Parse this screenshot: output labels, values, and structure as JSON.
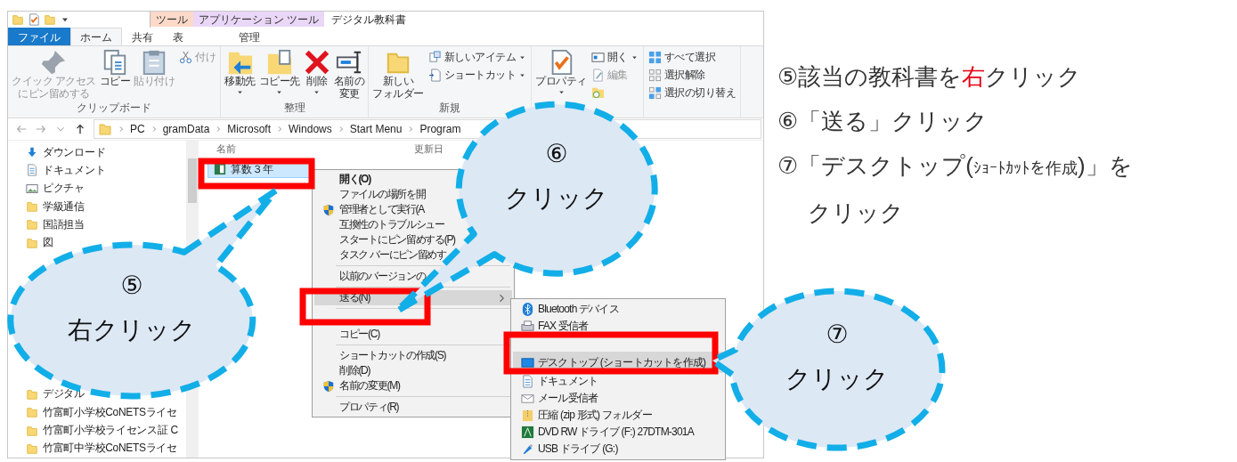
{
  "window": {
    "title": "デジタル教科書",
    "context_tabs": [
      {
        "label": "ツール",
        "color": "#fcd9c9"
      },
      {
        "label": "アプリケーション ツール",
        "color": "#ead7f7",
        "tab": {
          "label": "管理",
          "selected": false
        }
      }
    ]
  },
  "tabs": [
    {
      "label": "ファイル",
      "kind": "file",
      "selected": false
    },
    {
      "label": "ホーム",
      "kind": "tab",
      "selected": true
    },
    {
      "label": "共有",
      "kind": "tab",
      "selected": false
    },
    {
      "label": "表",
      "kind": "tab",
      "selected": false
    }
  ],
  "ribbon": {
    "groups": [
      {
        "label": "クリップボード",
        "items": [
          {
            "lines": [
              "クイック アクセス",
              "にピン留めする"
            ],
            "kind": "large",
            "disabled": true
          },
          {
            "lines": [
              "コピー"
            ],
            "kind": "large",
            "disabled": false
          },
          {
            "lines": [
              "貼り付け"
            ],
            "kind": "large",
            "disabled": true
          },
          {
            "lines": [
              "付け"
            ],
            "kind": "small",
            "disabled": true
          }
        ]
      },
      {
        "label": "整理",
        "items": [
          {
            "lines": [
              "移動先"
            ],
            "kind": "large",
            "disabled": false,
            "dropdown": true
          },
          {
            "lines": [
              "コピー先"
            ],
            "kind": "large",
            "disabled": false,
            "dropdown": true
          },
          {
            "lines": [
              "削除"
            ],
            "kind": "large",
            "disabled": false,
            "dropdown": true
          },
          {
            "lines": [
              "名前の",
              "変更"
            ],
            "kind": "large",
            "disabled": false
          }
        ]
      },
      {
        "label": "新規",
        "items": [
          {
            "lines": [
              "新しい",
              "フォルダー"
            ],
            "kind": "large",
            "disabled": false
          },
          {
            "lines": [
              "新しいアイテム"
            ],
            "kind": "small",
            "disabled": false,
            "dropdown": true
          },
          {
            "lines": [
              "ショートカット"
            ],
            "kind": "small",
            "disabled": false,
            "dropdown": true
          }
        ]
      },
      {
        "items": [
          {
            "lines": [
              "プロパティ"
            ],
            "kind": "large",
            "disabled": false,
            "dropdown": true
          },
          {
            "lines": [
              "開く"
            ],
            "kind": "small",
            "disabled": false,
            "dropdown": true
          },
          {
            "lines": [
              "編集"
            ],
            "kind": "small",
            "disabled": true
          },
          {
            "kind": "small"
          }
        ]
      },
      {
        "items": [
          {
            "lines": [
              "すべて選択"
            ],
            "kind": "small",
            "disabled": false
          },
          {
            "lines": [
              "選択解除"
            ],
            "kind": "small",
            "disabled": false
          },
          {
            "lines": [
              "選択の切り替え"
            ],
            "kind": "small",
            "disabled": false
          }
        ]
      }
    ]
  },
  "address_bar": {
    "crumbs": [
      "PC",
      "gramData",
      "Microsoft",
      "Windows",
      "Start Menu",
      "Program"
    ]
  },
  "nav_pane": {
    "items_top": [
      "ダウンロード",
      "ドキュメント",
      "ピクチャ",
      "学級通信",
      "国語担当",
      "図"
    ],
    "items_bottom": [
      "デジタル",
      "竹富町小学校CoNETSライセ",
      "竹富町小学校ライセンス証 C",
      "竹富町中学校CoNETSライセ"
    ]
  },
  "file_list": {
    "columns": [
      "名前",
      "更新日"
    ],
    "rows": [
      {
        "name": "算数３年",
        "selected": true
      }
    ]
  },
  "context_menu": {
    "items": [
      {
        "kind": "item",
        "label": "開く(O)",
        "bold": true,
        "selected": false
      },
      {
        "kind": "item",
        "label": "ファイルの場所を開",
        "selected": false
      },
      {
        "kind": "item",
        "label": "管理者として実行(A",
        "shield": true,
        "selected": false
      },
      {
        "kind": "item",
        "label": "互換性のトラブルシュー",
        "selected": false
      },
      {
        "kind": "item",
        "label": "スタートにピン留めする(P)",
        "selected": false
      },
      {
        "kind": "item",
        "label": "タスク バーにピン留めす",
        "selected": false
      },
      {
        "kind": "separator"
      },
      {
        "kind": "item",
        "label": "以前のバージョンの",
        "selected": false
      },
      {
        "kind": "separator"
      },
      {
        "kind": "item",
        "label": "送る(N)",
        "submenu": true,
        "selected": true
      },
      {
        "kind": "separator"
      },
      {
        "kind": "blank"
      },
      {
        "kind": "item",
        "label": "コピー(C)",
        "selected": false
      },
      {
        "kind": "separator"
      },
      {
        "kind": "item",
        "label": "ショートカットの作成(S)",
        "selected": false
      },
      {
        "kind": "item",
        "label": "削除(D)",
        "selected": false
      },
      {
        "kind": "item",
        "label": "名前の変更(M)",
        "shield": true,
        "selected": false
      },
      {
        "kind": "separator"
      },
      {
        "kind": "item",
        "label": "プロパティ(R)",
        "selected": false
      }
    ]
  },
  "send_to_menu": {
    "items": [
      {
        "kind": "item",
        "label": "Bluetooth デバイス",
        "selected": false
      },
      {
        "kind": "item",
        "label": "FAX 受信者",
        "selected": false
      },
      {
        "kind": "blank"
      },
      {
        "kind": "item",
        "label": "デスクトップ (ショートカットを作成)",
        "selected": true
      },
      {
        "kind": "item",
        "label": "ドキュメント",
        "selected": false
      },
      {
        "kind": "item",
        "label": "メール受信者",
        "selected": false
      },
      {
        "kind": "item",
        "label": "圧縮 (zip 形式) フォルダー",
        "selected": false
      },
      {
        "kind": "item",
        "label": "DVD RW ドライブ (F:) 27DTM-301A",
        "selected": false
      },
      {
        "kind": "item",
        "label": "USB ドライブ (G:)",
        "selected": false
      }
    ]
  },
  "callouts": [
    {
      "number": "⑤",
      "label": "右クリック"
    },
    {
      "number": "⑥",
      "label": "クリック"
    },
    {
      "number": "⑦",
      "label": "クリック"
    }
  ],
  "instructions": [
    {
      "parts": [
        {
          "text": "⑤該当の教科書を"
        },
        {
          "text": "右",
          "emphasis": true
        },
        {
          "text": "クリック"
        }
      ]
    },
    {
      "parts": [
        {
          "text": "⑥「送る」クリック"
        }
      ]
    },
    {
      "parts": [
        {
          "text": "⑦「デスクトップ("
        },
        {
          "text": "ｼｮｰﾄｶｯﾄを作成",
          "small": true
        },
        {
          "text": ")」を"
        }
      ]
    },
    {
      "indent": true,
      "parts": [
        {
          "text": "クリック"
        }
      ]
    }
  ]
}
